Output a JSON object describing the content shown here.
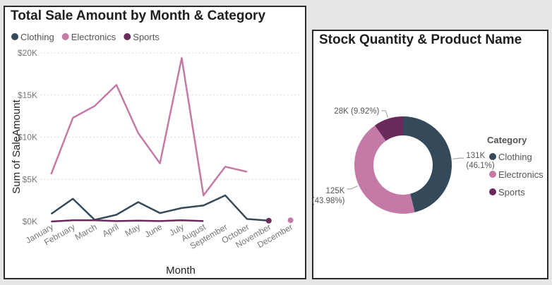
{
  "line_panel": {
    "title": "Total Sale Amount by Month & Category"
  },
  "donut_panel": {
    "title": "Stock Quantity & Product Name"
  },
  "chart_data": [
    {
      "type": "line",
      "title": "Total Sale Amount by Month & Category",
      "xlabel": "Month",
      "ylabel": "Sum of SaleAmount",
      "categories": [
        "January",
        "February",
        "March",
        "April",
        "May",
        "June",
        "July",
        "August",
        "September",
        "October",
        "November",
        "December"
      ],
      "yticks": [
        "$0K",
        "$5K",
        "$10K",
        "$15K",
        "$20K"
      ],
      "ylim": [
        0,
        20000
      ],
      "grid": true,
      "legend_position": "top-left",
      "series": [
        {
          "name": "Clothing",
          "color": "#34495a",
          "values": [
            900,
            2700,
            200,
            800,
            2300,
            1000,
            1600,
            1900,
            3100,
            300,
            100,
            null
          ]
        },
        {
          "name": "Electronics",
          "color": "#c47aa6",
          "values": [
            5600,
            12300,
            13700,
            16200,
            10500,
            6900,
            19400,
            3100,
            6500,
            5900,
            null,
            150
          ]
        },
        {
          "name": "Sports",
          "color": "#6b2a5c",
          "values": [
            0,
            150,
            150,
            50,
            100,
            50,
            150,
            50,
            null,
            null,
            100,
            null
          ]
        }
      ]
    },
    {
      "type": "pie",
      "title": "Stock Quantity & Product Name",
      "donut": true,
      "legend_title": "Category",
      "legend_position": "right",
      "slices": [
        {
          "name": "Clothing",
          "value": 131000,
          "label": "131K",
          "pct": "(46.1%)",
          "color": "#34495a"
        },
        {
          "name": "Electronics",
          "value": 125000,
          "label": "125K",
          "pct": "(43.98%)",
          "color": "#c47aa6"
        },
        {
          "name": "Sports",
          "value": 28000,
          "label": "28K",
          "pct": "(9.92%)",
          "color": "#6b2a5c"
        }
      ]
    }
  ]
}
